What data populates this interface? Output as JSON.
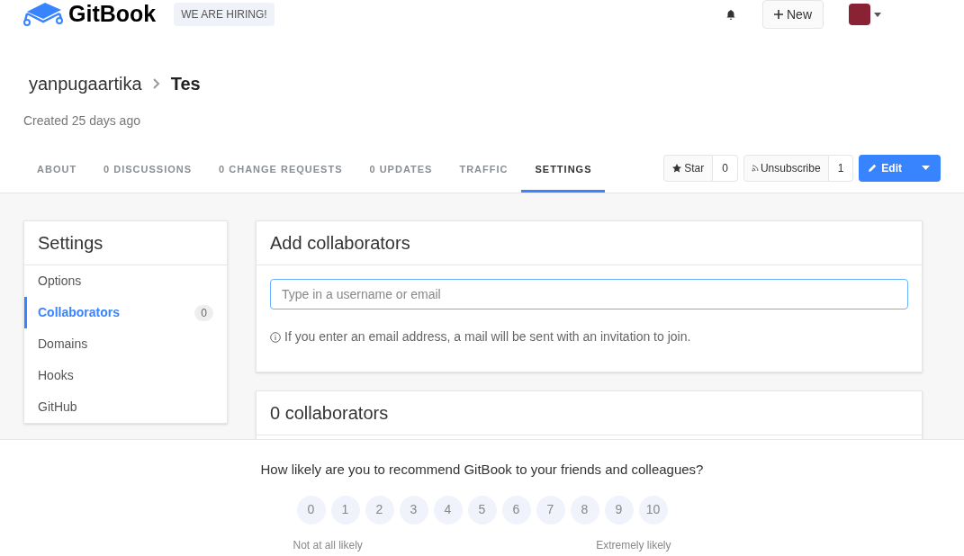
{
  "header": {
    "logo": "GitBook",
    "hiring": "WE ARE HIRING!",
    "new_button": "New"
  },
  "breadcrumb": {
    "owner": "yanpugaartika",
    "book": "Tes"
  },
  "created": "Created 25 days ago",
  "tabs": [
    {
      "label": "ABOUT",
      "selected": false
    },
    {
      "label": "0 DISCUSSIONS",
      "selected": false
    },
    {
      "label": "0 CHANGE REQUESTS",
      "selected": false
    },
    {
      "label": "0 UPDATES",
      "selected": false
    },
    {
      "label": "TRAFFIC",
      "selected": false
    },
    {
      "label": "SETTINGS",
      "selected": true
    }
  ],
  "actions": {
    "star": "Star",
    "star_count": "0",
    "unsubscribe": "Unsubscribe",
    "watch_count": "1",
    "edit": "Edit"
  },
  "sidebar": {
    "title": "Settings",
    "items": [
      {
        "label": "Options",
        "selected": false
      },
      {
        "label": "Collaborators",
        "selected": true,
        "count": "0"
      },
      {
        "label": "Domains",
        "selected": false
      },
      {
        "label": "Hooks",
        "selected": false
      },
      {
        "label": "GitHub",
        "selected": false
      }
    ]
  },
  "add_panel": {
    "title": "Add collaborators",
    "placeholder": "Type in a username or email",
    "hint": "If you enter an email address, a mail will be sent with an invitation to join."
  },
  "list_panel": {
    "title": "0 collaborators"
  },
  "survey": {
    "question": "How likely are you to recommend GitBook to your friends and colleagues?",
    "scores": [
      "0",
      "1",
      "2",
      "3",
      "4",
      "5",
      "6",
      "7",
      "8",
      "9",
      "10"
    ],
    "low_label": "Not at all likely",
    "high_label": "Extremely likely"
  }
}
